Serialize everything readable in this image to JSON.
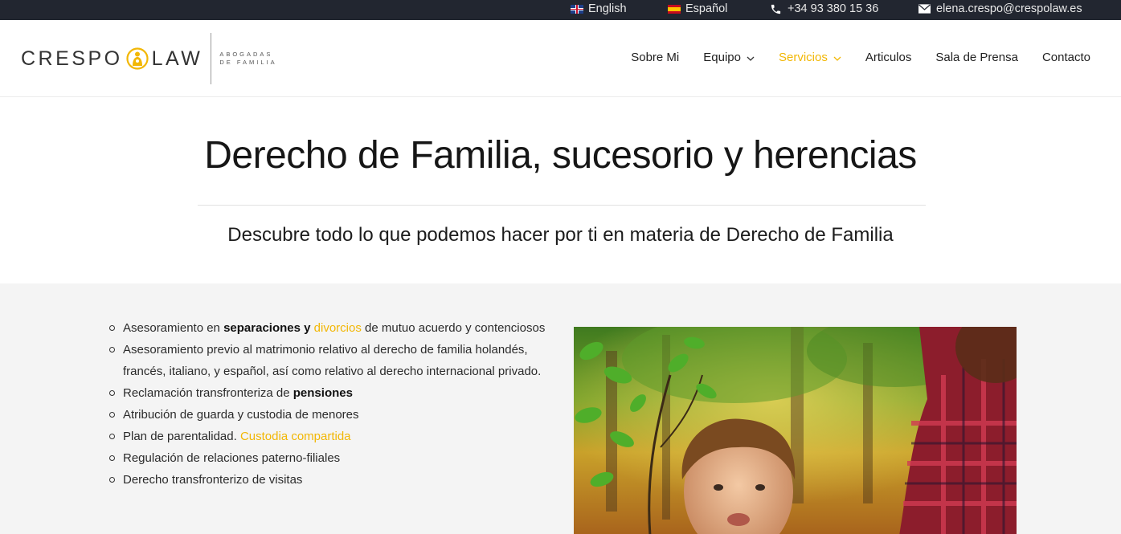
{
  "topbar": {
    "lang_english": "English",
    "lang_spanish": "Español",
    "phone": "+34 93 380 15 36",
    "email": "elena.crespo@crespolaw.es"
  },
  "logo": {
    "left_word": "CRESPO",
    "right_word": "LAW",
    "tagline_line1": "ABOGADAS",
    "tagline_line2": "DE FAMILIA"
  },
  "nav": {
    "items": [
      {
        "label": "Sobre Mi",
        "has_dropdown": false,
        "active": false
      },
      {
        "label": "Equipo",
        "has_dropdown": true,
        "active": false
      },
      {
        "label": "Servicios",
        "has_dropdown": true,
        "active": true
      },
      {
        "label": "Articulos",
        "has_dropdown": false,
        "active": false
      },
      {
        "label": "Sala de Prensa",
        "has_dropdown": false,
        "active": false
      },
      {
        "label": "Contacto",
        "has_dropdown": false,
        "active": false
      }
    ]
  },
  "hero": {
    "title": "Derecho de Familia, sucesorio y herencias",
    "subtitle": "Descubre todo lo que podemos hacer por ti en materia de Derecho de Familia"
  },
  "services": {
    "item1": {
      "pre": "Asesoramiento en ",
      "bold": "separaciones y ",
      "link": "divorcios",
      "post": " de mutuo acuerdo y contenciosos"
    },
    "item2": "Asesoramiento previo al matrimonio relativo al derecho de familia holandés, francés, italiano, y español, así como relativo al derecho internacional privado.",
    "item3": {
      "pre": "Reclamación transfronteriza de ",
      "bold": "pensiones"
    },
    "item4": "Atribución de guarda y custodia de menores",
    "item5": {
      "pre": "Plan de parentalidad. ",
      "link": "Custodia compartida"
    },
    "item6": "Regulación de relaciones paterno-filiales",
    "item7": "Derecho transfronterizo de visitas"
  },
  "colors": {
    "accent": "#f2b705",
    "topbar_bg": "#222630",
    "section_bg": "#f4f4f4"
  },
  "icons": {
    "phone": "phone-icon",
    "email": "envelope-icon",
    "dropdown": "chevron-down-icon"
  }
}
